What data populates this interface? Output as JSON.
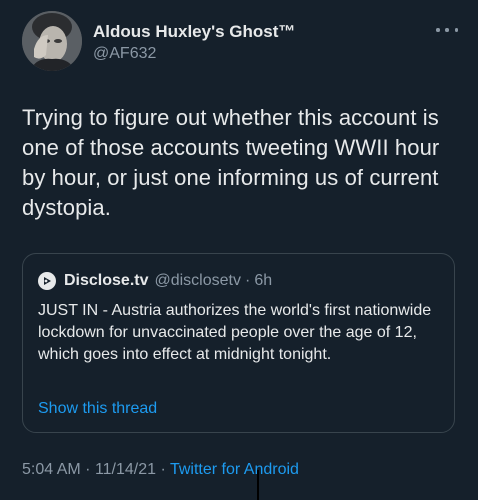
{
  "author": {
    "display_name": "Aldous Huxley's Ghost™",
    "handle": "@AF632"
  },
  "tweet": {
    "text": "Trying to figure out whether this account is one of those accounts tweeting WWII hour by hour, or just one informing us of current dystopia."
  },
  "quoted_tweet": {
    "name": "Disclose.tv",
    "handle": "@disclosetv",
    "separator": "·",
    "time": "6h",
    "text": "JUST IN - Austria authorizes the world's first nationwide lockdown for unvaccinated people over the age of 12, which goes into effect at midnight tonight.",
    "show_thread": "Show this thread"
  },
  "footer": {
    "time": "5:04 AM",
    "separator1": "·",
    "date": "11/14/21",
    "separator2": "·",
    "source": "Twitter for Android"
  },
  "icons": {
    "more": "more-options-icon",
    "quote_avatar": "disclose-logo-icon"
  },
  "colors": {
    "background": "#15202b",
    "text": "#e7e9ea",
    "secondary": "#8b98a5",
    "link": "#1d9bf0",
    "border": "#38444d"
  }
}
